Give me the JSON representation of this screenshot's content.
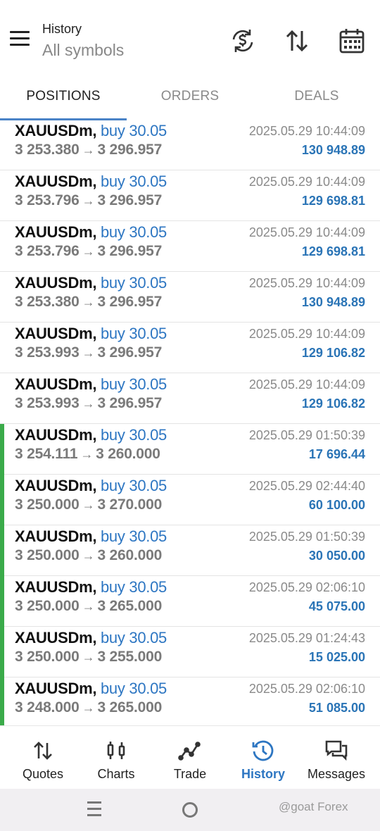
{
  "header": {
    "title_small": "History",
    "title_big": "All symbols"
  },
  "tabs": [
    {
      "label": "POSITIONS",
      "active": true
    },
    {
      "label": "ORDERS",
      "active": false
    },
    {
      "label": "DEALS",
      "active": false
    }
  ],
  "positions": [
    {
      "symbol": "XAUUSDm",
      "side": "buy 30.05",
      "open": "3 253.380",
      "close": "3 296.957",
      "time": "2025.05.29 10:44:09",
      "profit": "130 948.89",
      "bar": false
    },
    {
      "symbol": "XAUUSDm",
      "side": "buy 30.05",
      "open": "3 253.796",
      "close": "3 296.957",
      "time": "2025.05.29 10:44:09",
      "profit": "129 698.81",
      "bar": false
    },
    {
      "symbol": "XAUUSDm",
      "side": "buy 30.05",
      "open": "3 253.796",
      "close": "3 296.957",
      "time": "2025.05.29 10:44:09",
      "profit": "129 698.81",
      "bar": false
    },
    {
      "symbol": "XAUUSDm",
      "side": "buy 30.05",
      "open": "3 253.380",
      "close": "3 296.957",
      "time": "2025.05.29 10:44:09",
      "profit": "130 948.89",
      "bar": false
    },
    {
      "symbol": "XAUUSDm",
      "side": "buy 30.05",
      "open": "3 253.993",
      "close": "3 296.957",
      "time": "2025.05.29 10:44:09",
      "profit": "129 106.82",
      "bar": false
    },
    {
      "symbol": "XAUUSDm",
      "side": "buy 30.05",
      "open": "3 253.993",
      "close": "3 296.957",
      "time": "2025.05.29 10:44:09",
      "profit": "129 106.82",
      "bar": false
    },
    {
      "symbol": "XAUUSDm",
      "side": "buy 30.05",
      "open": "3 254.111",
      "close": "3 260.000",
      "time": "2025.05.29 01:50:39",
      "profit": "17 696.44",
      "bar": true
    },
    {
      "symbol": "XAUUSDm",
      "side": "buy 30.05",
      "open": "3 250.000",
      "close": "3 270.000",
      "time": "2025.05.29 02:44:40",
      "profit": "60 100.00",
      "bar": true
    },
    {
      "symbol": "XAUUSDm",
      "side": "buy 30.05",
      "open": "3 250.000",
      "close": "3 260.000",
      "time": "2025.05.29 01:50:39",
      "profit": "30 050.00",
      "bar": true
    },
    {
      "symbol": "XAUUSDm",
      "side": "buy 30.05",
      "open": "3 250.000",
      "close": "3 265.000",
      "time": "2025.05.29 02:06:10",
      "profit": "45 075.00",
      "bar": true
    },
    {
      "symbol": "XAUUSDm",
      "side": "buy 30.05",
      "open": "3 250.000",
      "close": "3 255.000",
      "time": "2025.05.29 01:24:43",
      "profit": "15 025.00",
      "bar": true
    },
    {
      "symbol": "XAUUSDm",
      "side": "buy 30.05",
      "open": "3 248.000",
      "close": "3 265.000",
      "time": "2025.05.29 02:06:10",
      "profit": "51 085.00",
      "bar": true
    }
  ],
  "nav": [
    {
      "label": "Quotes",
      "icon": "quotes-icon",
      "active": false
    },
    {
      "label": "Charts",
      "icon": "charts-icon",
      "active": false
    },
    {
      "label": "Trade",
      "icon": "trade-icon",
      "active": false
    },
    {
      "label": "History",
      "icon": "history-icon",
      "active": true
    },
    {
      "label": "Messages",
      "icon": "messages-icon",
      "active": false
    }
  ],
  "colors": {
    "accent": "#2d76c2",
    "profit": "#2a74b6",
    "closed_bar": "#3aab4a"
  },
  "watermark": "@goat Forex"
}
